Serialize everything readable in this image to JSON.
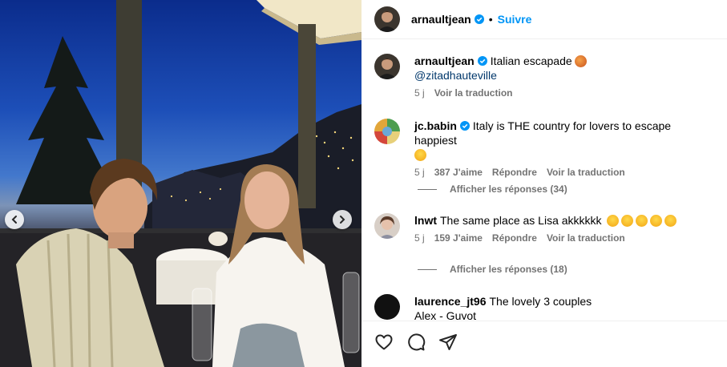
{
  "post": {
    "author": "arnaultjean",
    "follow_label": "Suivre",
    "separator": "•"
  },
  "caption": {
    "username": "arnaultjean",
    "text": "Italian escapade",
    "mention": "@zitadhauteville",
    "time": "5 j",
    "translate": "Voir la traduction"
  },
  "comments": [
    {
      "username": "jc.babin",
      "verified": true,
      "text": "Italy is THE country for lovers to escape happiest",
      "time": "5 j",
      "likes": "387 J'aime",
      "reply": "Répondre",
      "translate": "Voir la traduction",
      "replies_label": "Afficher les réponses (34)"
    },
    {
      "username": "lnwt",
      "verified": false,
      "text": "The same place as Lisa akkkkkk",
      "time": "5 j",
      "likes": "159 J'aime",
      "reply": "Répondre",
      "translate": "Voir la traduction",
      "replies_label": "Afficher les réponses (18)"
    },
    {
      "username": "laurence_jt96",
      "text": "The lovely 3 couples",
      "text_line2": "Alex - Guyot"
    }
  ],
  "icons": {
    "like": "heart-icon",
    "comment": "comment-icon",
    "share": "share-icon",
    "prev": "chevron-left-icon",
    "next": "chevron-right-icon",
    "verified": "verified-badge-icon"
  },
  "colors": {
    "link": "#0095f6",
    "verified": "#0095f6",
    "meta": "#737373",
    "mention": "#00376b"
  }
}
